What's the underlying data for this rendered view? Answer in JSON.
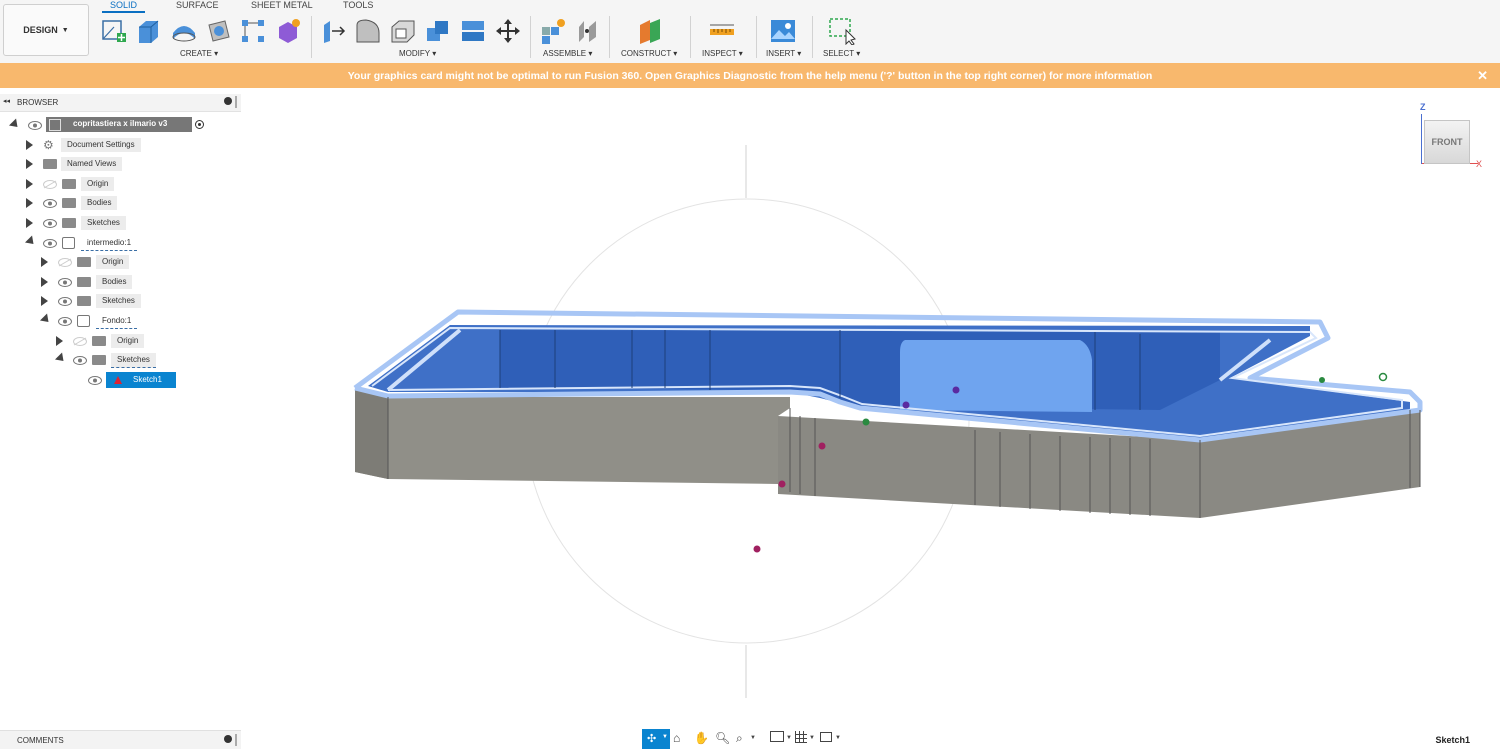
{
  "toolbar": {
    "design_label": "DESIGN",
    "tabs": [
      {
        "label": "SOLID",
        "active": true
      },
      {
        "label": "SURFACE",
        "active": false
      },
      {
        "label": "SHEET METAL",
        "active": false
      },
      {
        "label": "TOOLS",
        "active": false
      }
    ],
    "groups": {
      "create": "CREATE",
      "modify": "MODIFY",
      "assemble": "ASSEMBLE",
      "construct": "CONSTRUCT",
      "inspect": "INSPECT",
      "insert": "INSERT",
      "select": "SELECT"
    },
    "accent_color": "#0a6fc2"
  },
  "warning": {
    "message": "Your graphics card might not be optimal to run Fusion 360. Open Graphics Diagnostic from the help menu ('?' button in the top right corner) for more information",
    "close_symbol": "✕",
    "color": "#f8b86d"
  },
  "browser": {
    "title": "BROWSER",
    "collapse_symbol": "◂◂",
    "root": "copritastiera x ilmario v3",
    "items": [
      {
        "label": "Document Settings"
      },
      {
        "label": "Named Views"
      },
      {
        "label": "Origin"
      },
      {
        "label": "Bodies"
      },
      {
        "label": "Sketches"
      },
      {
        "label": "intermedio:1"
      },
      {
        "label": "Origin"
      },
      {
        "label": "Bodies"
      },
      {
        "label": "Sketches"
      },
      {
        "label": "Fondo:1"
      },
      {
        "label": "Origin"
      },
      {
        "label": "Sketches"
      },
      {
        "label": "Sketch1"
      }
    ]
  },
  "viewcube": {
    "face": "FRONT",
    "axis_z": "Z",
    "axis_x": "X"
  },
  "comments": {
    "title": "COMMENTS"
  },
  "status": {
    "active_sketch": "Sketch1"
  }
}
